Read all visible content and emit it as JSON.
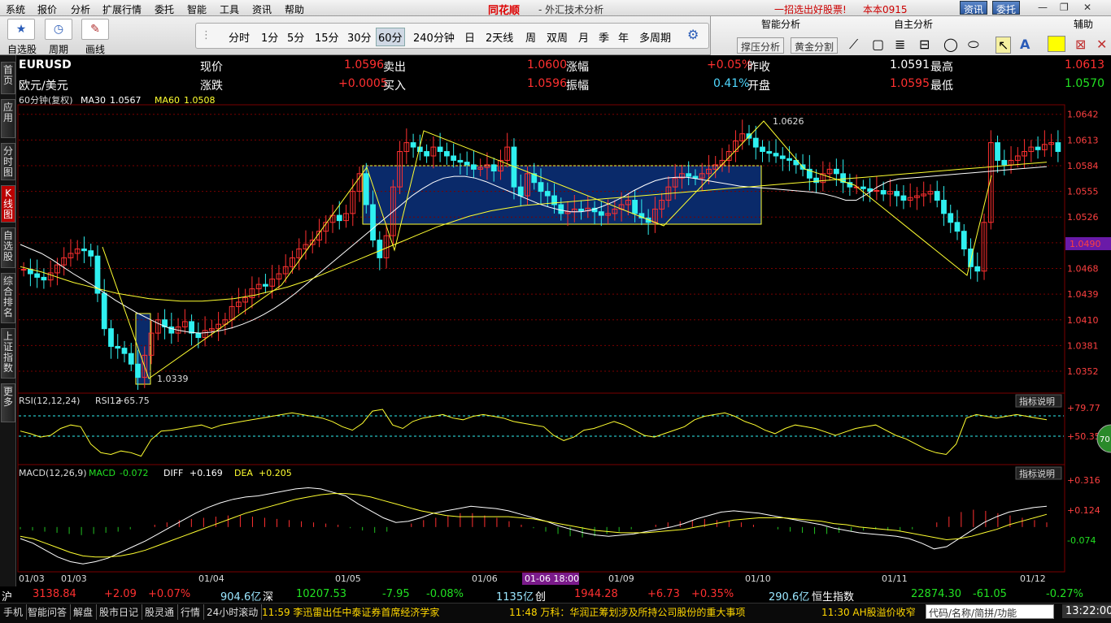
{
  "menu": {
    "items": [
      "系统",
      "报价",
      "分析",
      "扩展行情",
      "委托",
      "智能",
      "工具",
      "资讯",
      "帮助"
    ],
    "brand": "同花顺",
    "title": "- 外汇技术分析",
    "promo": "一招选出好股票!",
    "version": "本本0915",
    "btn_info": "资讯",
    "btn_trade": "委托",
    "win_controls": [
      "—",
      "❐",
      "✕"
    ]
  },
  "toolbar": {
    "tools": [
      {
        "label": "自选股",
        "icon": "star-icon"
      },
      {
        "label": "周期",
        "icon": "clock-icon"
      },
      {
        "label": "画线",
        "icon": "pencil-icon"
      }
    ],
    "periods": [
      "分时",
      "1分",
      "5分",
      "15分",
      "30分",
      "60分",
      "240分钟",
      "日",
      "2天线",
      "周",
      "双周",
      "月",
      "季",
      "年",
      "多周期"
    ],
    "selected_period": "60分"
  },
  "ai_panel": {
    "headers": [
      "智能分析",
      "自主分析",
      "辅助"
    ],
    "buttons": [
      "撑压分析",
      "黄金分割"
    ]
  },
  "sidebar": [
    "首页",
    "应用",
    "分时图",
    "K线图",
    "自选股",
    "综合排名",
    "上证指数",
    "更多"
  ],
  "sidebar_selected": "K线图",
  "quote": {
    "symbol": "EURUSD",
    "name": "欧元/美元",
    "fields": [
      {
        "label": "现价",
        "value": "1.0596"
      },
      {
        "label": "卖出",
        "value": "1.0600"
      },
      {
        "label": "涨幅",
        "value": "+0.05%"
      },
      {
        "label": "昨收",
        "value": "1.0591"
      },
      {
        "label": "最高",
        "value": "1.0613"
      },
      {
        "label": "涨跌",
        "value": "+0.0005"
      },
      {
        "label": "买入",
        "value": "1.0596"
      },
      {
        "label": "振幅",
        "value": "0.41%"
      },
      {
        "label": "开盘",
        "value": "1.0595"
      },
      {
        "label": "最低",
        "value": "1.0570"
      }
    ]
  },
  "colors": {
    "up": "#ff3030",
    "down": "#2ff0f0",
    "ma30": "#ffffff",
    "ma60": "#ffff30",
    "box": "#0a2a6a",
    "grid": "#7a0000"
  },
  "chart_data": [
    {
      "type": "candlestick",
      "title": "60分钟(复权)",
      "indicators": [
        {
          "name": "MA30",
          "value": "1.0567"
        },
        {
          "name": "MA60",
          "value": "1.0508"
        }
      ],
      "y_ticks": [
        "1.0642",
        "1.0613",
        "1.0584",
        "1.0555",
        "1.0526",
        "1.0497",
        "1.0468",
        "1.0439",
        "1.0410",
        "1.0381",
        "1.0352"
      ],
      "ylim": [
        1.033,
        1.065
      ],
      "current_price_tag": "1.0490",
      "annotations": [
        {
          "label": "1.0626",
          "x": "01/10"
        },
        {
          "label": "1.0339",
          "x": "01/03"
        }
      ],
      "x_labels": [
        "01/03",
        "01/03",
        "01/04",
        "01/05",
        "01/06",
        "01/09",
        "01/10",
        "01/11",
        "01/12"
      ],
      "crosshair_label": "01-06 18:00",
      "closes": [
        1.0467,
        1.0462,
        1.0458,
        1.0455,
        1.0463,
        1.0472,
        1.048,
        1.0485,
        1.049,
        1.0488,
        1.0482,
        1.044,
        1.04,
        1.038,
        1.0378,
        1.0372,
        1.036,
        1.0345,
        1.037,
        1.0395,
        1.041,
        1.0402,
        1.0395,
        1.0402,
        1.0408,
        1.0395,
        1.039,
        1.0398,
        1.04,
        1.0405,
        1.041,
        1.0425,
        1.043,
        1.0435,
        1.0445,
        1.045,
        1.0448,
        1.0456,
        1.0462,
        1.047,
        1.048,
        1.049,
        1.0495,
        1.05,
        1.051,
        1.052,
        1.0528,
        1.0522,
        1.053,
        1.0555,
        1.0575,
        1.054,
        1.05,
        1.048,
        1.0505,
        1.056,
        1.06,
        1.061,
        1.0605,
        1.06,
        1.0595,
        1.0605,
        1.06,
        1.0595,
        1.059,
        1.0588,
        1.0585,
        1.058,
        1.0582,
        1.0585,
        1.0578,
        1.059,
        1.0605,
        1.056,
        1.055,
        1.0575,
        1.0565,
        1.0555,
        1.055,
        1.054,
        1.053,
        1.0532,
        1.0535,
        1.0533,
        1.0536,
        1.0532,
        1.0528,
        1.053,
        1.0535,
        1.054,
        1.0545,
        1.053,
        1.0525,
        1.052,
        1.0535,
        1.0545,
        1.056,
        1.057,
        1.0575,
        1.0572,
        1.057,
        1.0575,
        1.058,
        1.0585,
        1.059,
        1.06,
        1.0612,
        1.062,
        1.0615,
        1.0605,
        1.06,
        1.0598,
        1.0595,
        1.0592,
        1.059,
        1.0585,
        1.058,
        1.057,
        1.0565,
        1.0575,
        1.058,
        1.0575,
        1.0565,
        1.056,
        1.056,
        1.0558,
        1.0555,
        1.0556,
        1.0552,
        1.0555,
        1.055,
        1.0545,
        1.0548,
        1.055,
        1.0552,
        1.0555,
        1.0545,
        1.053,
        1.052,
        1.051,
        1.049,
        1.047,
        1.0465,
        1.052,
        1.061,
        1.059,
        1.0585,
        1.059,
        1.0595,
        1.06,
        1.0605,
        1.0602,
        1.0608,
        1.061,
        1.06
      ],
      "ma30": [
        1.0495,
        1.049,
        1.0485,
        1.0478,
        1.047,
        1.0462,
        1.0455,
        1.0448,
        1.044,
        1.0432,
        1.0425,
        1.0418,
        1.0412,
        1.0406,
        1.0401,
        1.0398,
        1.0396,
        1.0395,
        1.0396,
        1.0398,
        1.0401,
        1.0405,
        1.041,
        1.0416,
        1.0423,
        1.0431,
        1.044,
        1.045,
        1.046,
        1.047,
        1.048,
        1.049,
        1.05,
        1.051,
        1.052,
        1.053,
        1.054,
        1.055,
        1.0558,
        1.0565,
        1.057,
        1.0572,
        1.0572,
        1.057,
        1.0566,
        1.0561,
        1.0556,
        1.0551,
        1.0546,
        1.0541,
        1.0537,
        1.0534,
        1.0532,
        1.0532,
        1.0534,
        1.0538,
        1.0543,
        1.0549,
        1.0556,
        1.0562,
        1.0567,
        1.057,
        1.0571,
        1.0571,
        1.0569,
        1.0567,
        1.0565,
        1.0563,
        1.0561,
        1.056,
        1.0559,
        1.0558,
        1.0557,
        1.0556,
        1.0555,
        1.0554,
        1.0552,
        1.0549,
        1.0545,
        1.0545,
        1.0552,
        1.056,
        1.0566,
        1.0569,
        1.057,
        1.0571,
        1.0572,
        1.0573,
        1.0574,
        1.0575,
        1.0576,
        1.0577,
        1.0578,
        1.0579,
        1.058,
        1.0581,
        1.0582,
        1.0583
      ],
      "ma60": [
        1.047,
        1.0467,
        1.0464,
        1.046,
        1.0456,
        1.0452,
        1.0449,
        1.0446,
        1.0443,
        1.044,
        1.0438,
        1.0436,
        1.0434,
        1.0433,
        1.0432,
        1.0431,
        1.0431,
        1.0431,
        1.0432,
        1.0433,
        1.0434,
        1.0436,
        1.0438,
        1.0441,
        1.0444,
        1.0447,
        1.0451,
        1.0455,
        1.046,
        1.0465,
        1.047,
        1.0475,
        1.048,
        1.0485,
        1.049,
        1.0495,
        1.05,
        1.0505,
        1.051,
        1.0515,
        1.0519,
        1.0523,
        1.0527,
        1.053,
        1.0533,
        1.0535,
        1.0537,
        1.0539,
        1.054,
        1.0541,
        1.0542,
        1.0543,
        1.0544,
        1.0545,
        1.0546,
        1.0547,
        1.0548,
        1.0549,
        1.055,
        1.0551,
        1.0552,
        1.0553,
        1.0554,
        1.0555,
        1.0556,
        1.0557,
        1.0558,
        1.0559,
        1.056,
        1.0561,
        1.0562,
        1.0563,
        1.0564,
        1.0565,
        1.0566,
        1.0567,
        1.0568,
        1.0569,
        1.057,
        1.0571,
        1.0572,
        1.0573,
        1.0574,
        1.0575,
        1.0576,
        1.0577,
        1.0578,
        1.0579,
        1.058,
        1.0581,
        1.0582,
        1.0583,
        1.0584,
        1.0585,
        1.0586,
        1.0587,
        1.0588
      ]
    },
    {
      "type": "line",
      "title": "RSI(12,12,24)",
      "indicators": [
        {
          "name": "RSI12",
          "value": "+65.75"
        }
      ],
      "y_ticks": [
        "+79.77",
        "+50.35"
      ],
      "ylim": [
        20,
        95
      ],
      "badge": "70",
      "values": [
        55,
        52,
        48,
        50,
        58,
        62,
        60,
        40,
        30,
        28,
        32,
        30,
        26,
        45,
        55,
        56,
        58,
        60,
        62,
        58,
        62,
        64,
        66,
        68,
        70,
        72,
        74,
        76,
        74,
        72,
        70,
        66,
        60,
        56,
        64,
        78,
        80,
        62,
        58,
        66,
        70,
        72,
        74,
        70,
        68,
        72,
        74,
        72,
        70,
        66,
        64,
        62,
        60,
        50,
        44,
        48,
        56,
        58,
        62,
        66,
        62,
        56,
        50,
        48,
        52,
        56,
        60,
        68,
        72,
        74,
        76,
        72,
        66,
        62,
        56,
        52,
        58,
        62,
        60,
        58,
        54,
        50,
        54,
        58,
        60,
        62,
        56,
        50,
        46,
        40,
        34,
        30,
        28,
        40,
        70,
        74,
        72,
        70,
        72,
        74,
        72,
        70,
        68
      ]
    },
    {
      "type": "bar",
      "title": "MACD(12,26,9)",
      "indicators": [
        {
          "name": "MACD",
          "value": "-0.072"
        },
        {
          "name": "DIFF",
          "value": "+0.169"
        },
        {
          "name": "DEA",
          "value": "+0.205"
        }
      ],
      "y_ticks": [
        "+0.316",
        "+0.124",
        "-0.074"
      ],
      "ylim": [
        -0.36,
        0.4
      ],
      "histogram": [
        -0.02,
        -0.03,
        -0.04,
        -0.05,
        -0.06,
        -0.07,
        -0.06,
        -0.05,
        -0.04,
        -0.02,
        0.0,
        0.02,
        0.04,
        0.06,
        0.07,
        0.08,
        0.09,
        0.1,
        0.1,
        0.09,
        0.08,
        0.07,
        0.06,
        0.05,
        0.04,
        0.03,
        0.02,
        -0.01,
        -0.03,
        -0.05,
        -0.04,
        0.0,
        0.03,
        0.06,
        0.08,
        0.1,
        0.12,
        0.12,
        0.1,
        0.08,
        0.05,
        0.02,
        -0.01,
        -0.04,
        -0.06,
        -0.08,
        -0.09,
        -0.08,
        -0.06,
        -0.04,
        -0.02,
        0.0,
        0.02,
        0.04,
        0.05,
        0.06,
        0.07,
        0.06,
        0.05,
        0.04,
        0.02,
        0.0,
        -0.02,
        -0.04,
        -0.05,
        -0.06,
        -0.06,
        -0.05,
        -0.04,
        -0.03,
        -0.02,
        -0.03,
        -0.04,
        -0.02,
        0.0,
        0.04,
        0.09,
        0.13,
        0.15,
        0.14,
        0.12,
        0.1,
        0.08,
        0.06,
        0.04
      ],
      "diff": [
        -0.1,
        -0.14,
        -0.2,
        -0.26,
        -0.3,
        -0.32,
        -0.3,
        -0.27,
        -0.22,
        -0.17,
        -0.12,
        -0.06,
        0.0,
        0.06,
        0.12,
        0.17,
        0.21,
        0.24,
        0.26,
        0.27,
        0.29,
        0.31,
        0.33,
        0.34,
        0.33,
        0.3,
        0.27,
        0.2,
        0.14,
        0.08,
        0.04,
        0.05,
        0.08,
        0.12,
        0.14,
        0.16,
        0.18,
        0.17,
        0.16,
        0.14,
        0.11,
        0.08,
        0.05,
        0.01,
        -0.02,
        -0.05,
        -0.07,
        -0.08,
        -0.07,
        -0.06,
        -0.04,
        -0.02,
        0.0,
        0.03,
        0.07,
        0.1,
        0.13,
        0.14,
        0.13,
        0.12,
        0.1,
        0.08,
        0.06,
        0.04,
        0.02,
        -0.01,
        -0.03,
        -0.05,
        -0.06,
        -0.07,
        -0.08,
        -0.1,
        -0.14,
        -0.19,
        -0.17,
        -0.1,
        -0.03,
        0.04,
        0.09,
        0.13,
        0.15,
        0.17,
        0.18
      ],
      "dea": [
        -0.08,
        -0.1,
        -0.14,
        -0.18,
        -0.22,
        -0.25,
        -0.26,
        -0.26,
        -0.25,
        -0.23,
        -0.2,
        -0.16,
        -0.12,
        -0.08,
        -0.04,
        0.0,
        0.04,
        0.08,
        0.12,
        0.15,
        0.18,
        0.21,
        0.24,
        0.26,
        0.28,
        0.29,
        0.29,
        0.28,
        0.26,
        0.23,
        0.2,
        0.17,
        0.14,
        0.12,
        0.1,
        0.09,
        0.09,
        0.09,
        0.09,
        0.09,
        0.08,
        0.07,
        0.05,
        0.03,
        0.01,
        -0.01,
        -0.03,
        -0.04,
        -0.05,
        -0.05,
        -0.05,
        -0.04,
        -0.03,
        -0.02,
        0.0,
        0.02,
        0.04,
        0.06,
        0.07,
        0.08,
        0.08,
        0.08,
        0.07,
        0.06,
        0.05,
        0.03,
        0.02,
        0.0,
        -0.01,
        -0.02,
        -0.03,
        -0.05,
        -0.07,
        -0.09,
        -0.11,
        -0.1,
        -0.08,
        -0.05,
        -0.02,
        0.02,
        0.05,
        0.08,
        0.11
      ],
      "label_right": "指标说明"
    }
  ],
  "indicator_help": "指标说明",
  "status": [
    {
      "label": "沪",
      "v1": "3138.84",
      "v2": "+2.09",
      "v3": "+0.07%",
      "v4": "904.6亿"
    },
    {
      "label": "深",
      "v1": "10207.53",
      "v2": "-7.95",
      "v3": "-0.08%",
      "v4": "1135亿"
    },
    {
      "label": "创",
      "v1": "1944.28",
      "v2": "+6.73",
      "v3": "+0.35%",
      "v4": "290.6亿"
    },
    {
      "label": "恒生指数",
      "v1": "22874.30",
      "v2": "-61.05",
      "v3": "-0.27%",
      "v4": ""
    }
  ],
  "bottom": {
    "buttons": [
      "手机",
      "智能问答",
      "解盘",
      "股市日记",
      "股灵通",
      "行情",
      "24小时滚动"
    ],
    "news": [
      "11:59 李迅雷出任中泰证券首席经济学家",
      "11:48 万科：华润正筹划涉及所持公司股份的重大事项",
      "11:30 AH股溢价收窄"
    ],
    "code_placeholder": "代码/名称/简拼/功能",
    "clock": "13:22:00"
  }
}
